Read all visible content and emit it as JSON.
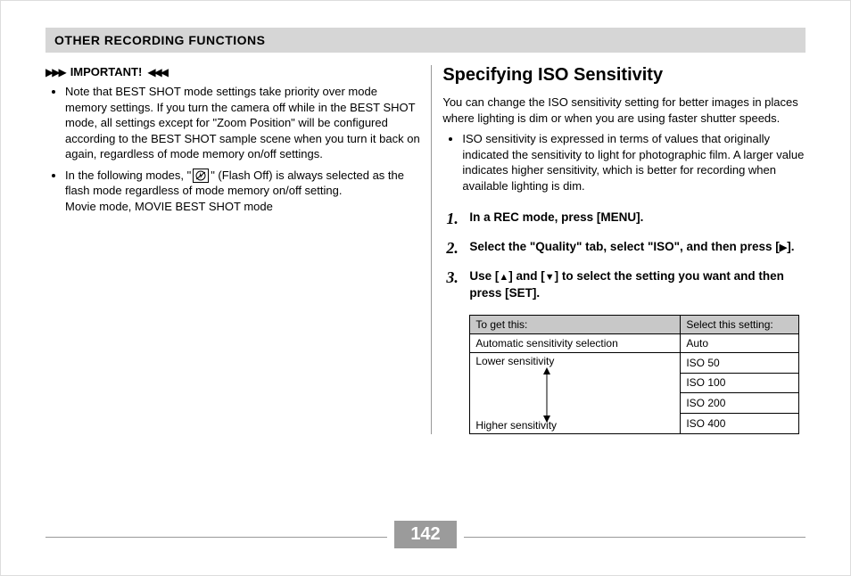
{
  "header": {
    "title": "OTHER RECORDING FUNCTIONS"
  },
  "left": {
    "important_label": "IMPORTANT!",
    "deco_left": "▶▶▶",
    "deco_right": "◀◀◀",
    "flash_icon_name": "flash-off-icon",
    "bullet1": "Note that BEST SHOT mode settings take priority over mode memory settings. If you turn the camera off while in the BEST SHOT mode, all settings except for \"Zoom Position\" will be configured according to the BEST SHOT sample scene when you turn it back on again, regardless of mode memory on/off settings.",
    "bullet2_pre": "In the following modes, \"",
    "bullet2_post": "\" (Flash Off) is always selected as the flash mode regardless of mode memory on/off setting.",
    "bullet2_line2": "Movie mode, MOVIE BEST SHOT mode"
  },
  "right": {
    "heading": "Specifying ISO Sensitivity",
    "intro": "You can change the ISO sensitivity setting for better images in places where lighting is dim or when you are using faster shutter speeds.",
    "intro_bullet": "ISO sensitivity is expressed in terms of values that originally indicated the sensitivity to light for photographic film. A larger value indicates higher sensitivity, which is better for recording when available lighting is dim.",
    "steps": {
      "s1": "In a REC mode, press [MENU].",
      "s2_a": "Select the \"Quality\" tab, select \"ISO\", and then press [",
      "s2_b": "].",
      "s3_a": "Use [",
      "s3_b": "] and [",
      "s3_c": "] to select the setting you want and then press [SET]."
    },
    "table": {
      "th1": "To get this:",
      "th2": "Select this setting:",
      "row1_left": "Automatic sensitivity selection",
      "row1_right": "Auto",
      "lower_label": "Lower sensitivity",
      "higher_label": "Higher sensitivity",
      "r2": "ISO 50",
      "r3": "ISO 100",
      "r4": "ISO 200",
      "r5": "ISO 400"
    }
  },
  "page_number": "142"
}
